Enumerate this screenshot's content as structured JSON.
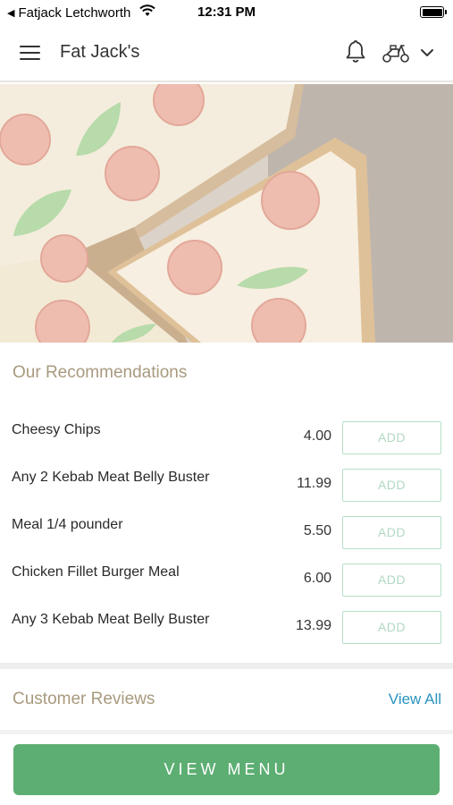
{
  "status_bar": {
    "back_arrow": "◀",
    "carrier": "Fatjack Letchworth",
    "time": "12:31 PM"
  },
  "header": {
    "title": "Fat Jack's",
    "icons": [
      "menu-icon",
      "bell-icon",
      "scooter-icon",
      "chevron-down-icon"
    ]
  },
  "recommendations": {
    "title": "Our Recommendations",
    "add_label": "ADD",
    "items": [
      {
        "name": "Cheesy Chips",
        "price": "4.00"
      },
      {
        "name": "Any 2 Kebab Meat Belly Buster",
        "price": "11.99"
      },
      {
        "name": "Meal 1/4 pounder",
        "price": "5.50"
      },
      {
        "name": "Chicken Fillet Burger Meal",
        "price": "6.00"
      },
      {
        "name": "Any 3 Kebab Meat Belly Buster",
        "price": "13.99"
      }
    ]
  },
  "reviews": {
    "title": "Customer Reviews",
    "view_all": "View All"
  },
  "footer": {
    "view_menu_label": "VIEW MENU"
  },
  "colors": {
    "accent_green": "#5cae72",
    "section_title": "#a89a7e",
    "link_blue": "#2a93bf",
    "add_border": "#b6e0c7"
  }
}
